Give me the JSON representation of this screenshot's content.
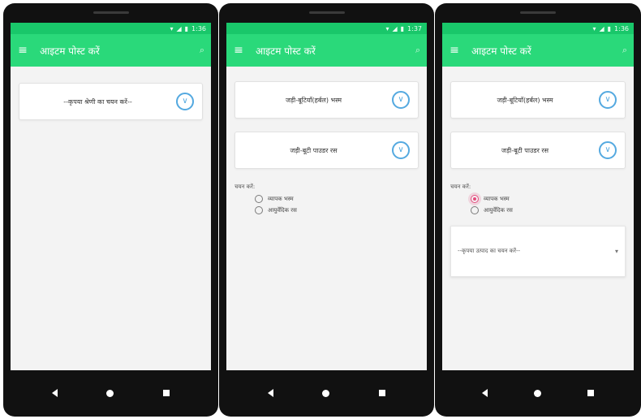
{
  "status": {
    "time_1": "1:36",
    "time_2": "1:37",
    "time_3": "1:36"
  },
  "app": {
    "title": "आइटम पोस्ट करें"
  },
  "screen1": {
    "select_placeholder": "--कृपया श्रेणी का चयन करें--"
  },
  "screen2": {
    "category": "जड़ी-बूटियाँ(हर्बल) भस्म",
    "subcategory": "जड़ी-बूटी पाउडर रस",
    "section_label": "चयन करें:",
    "options": [
      "व्यापक भस्म",
      "आयुर्वेदिक रस"
    ]
  },
  "screen3": {
    "category": "जड़ी-बूटियाँ(हर्बल) भस्म",
    "subcategory": "जड़ी-बूटी पाउडर रस",
    "section_label": "चयन करें:",
    "options": [
      "व्यापक भस्म",
      "आयुर्वेदिक रस"
    ],
    "selected_option": "व्यापक भस्म",
    "dropdown_placeholder": "--कृपया उत्पाद का चयन करें--"
  },
  "icons": {
    "menu": "hamburger-menu",
    "search": "magnifier",
    "chevron": "chevron-down-circle",
    "caret": "caret-down"
  },
  "colors": {
    "statusbar": "#19c76a",
    "appbar": "#2ad97a",
    "accent_blue": "#54a9e0",
    "radio_selected": "#e54b7e"
  }
}
